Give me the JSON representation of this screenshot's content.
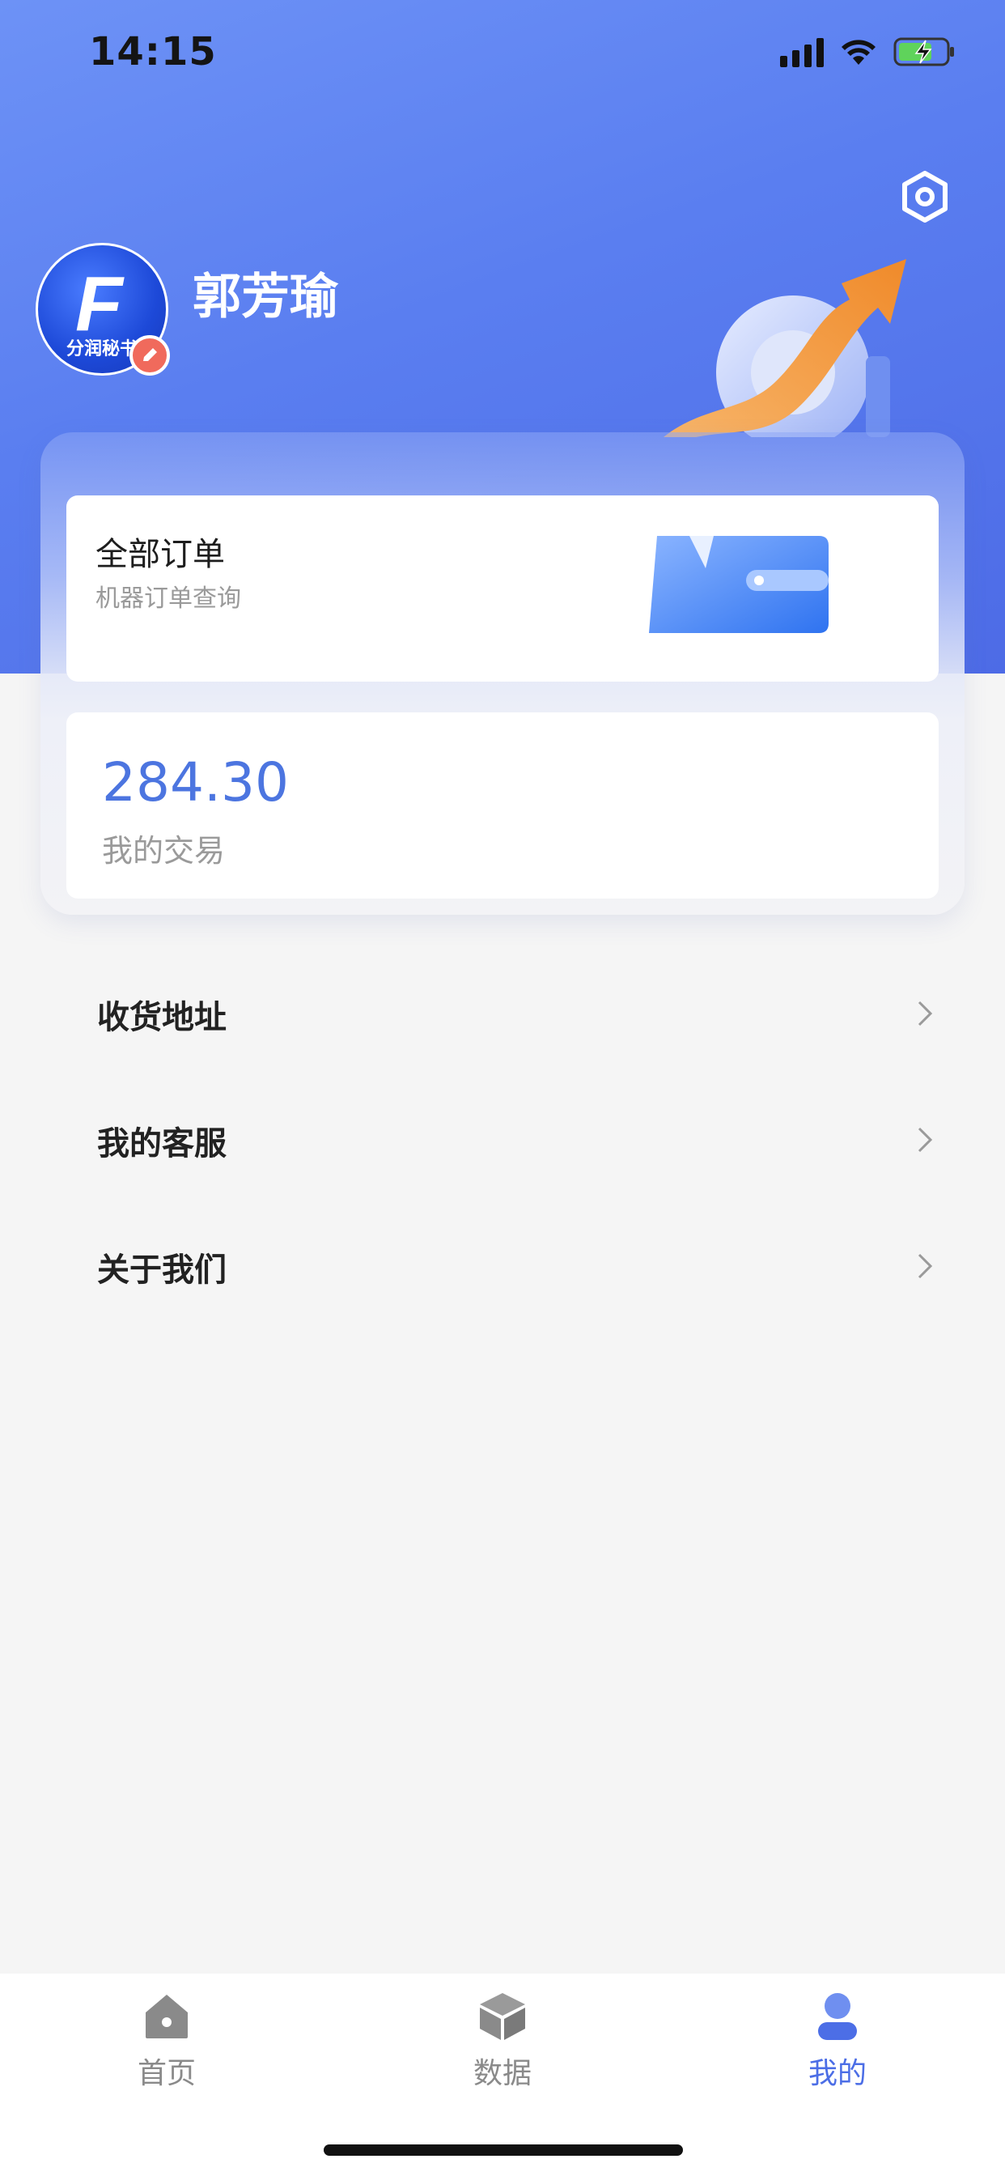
{
  "status_bar": {
    "time": "14:15"
  },
  "profile": {
    "username": "郭芳瑜",
    "avatar_letter": "F",
    "avatar_text": "分润秘书",
    "icons": {
      "settings": "settings-icon",
      "edit": "edit-pencil-icon"
    }
  },
  "orders_card": {
    "title": "全部订单",
    "subtitle": "机器订单查询",
    "icon": "wallet-icon"
  },
  "trade_card": {
    "value": "284.30",
    "label": "我的交易"
  },
  "menu": {
    "items": [
      {
        "label": "收货地址",
        "icon": "chevron-right-icon"
      },
      {
        "label": "我的客服",
        "icon": "chevron-right-icon"
      },
      {
        "label": "关于我们",
        "icon": "chevron-right-icon"
      }
    ]
  },
  "tabbar": {
    "tabs": [
      {
        "label": "首页",
        "icon": "home-icon",
        "active": false
      },
      {
        "label": "数据",
        "icon": "cube-icon",
        "active": false
      },
      {
        "label": "我的",
        "icon": "user-icon",
        "active": true
      }
    ]
  },
  "colors": {
    "accent": "#4c6ee6",
    "header_blue": "#5a7ef0",
    "badge_red": "#f06a5c",
    "trade_value": "#4c75e0"
  }
}
